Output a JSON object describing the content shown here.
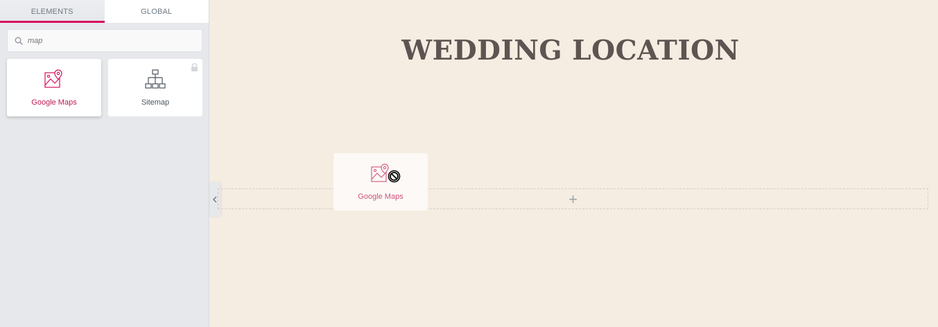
{
  "sidebar": {
    "tabs": [
      {
        "label": "ELEMENTS",
        "active": true
      },
      {
        "label": "GLOBAL",
        "active": false
      }
    ],
    "search": {
      "value": "",
      "placeholder": "map"
    },
    "widgets": [
      {
        "label": "Google Maps",
        "icon": "map-pin-icon",
        "locked": false
      },
      {
        "label": "Sitemap",
        "icon": "sitemap-icon",
        "locked": true
      }
    ]
  },
  "canvas": {
    "heading": "WEDDING LOCATION",
    "add_section_symbol": "+",
    "drag_ghost": {
      "label": "Google Maps",
      "icon": "map-pin-icon",
      "cursor": "no-drop-icon"
    }
  },
  "colors": {
    "accent": "#d5115f",
    "canvas_bg": "#f5ede1",
    "sidebar_bg": "#e6e8eb",
    "heading": "#5e5451"
  }
}
